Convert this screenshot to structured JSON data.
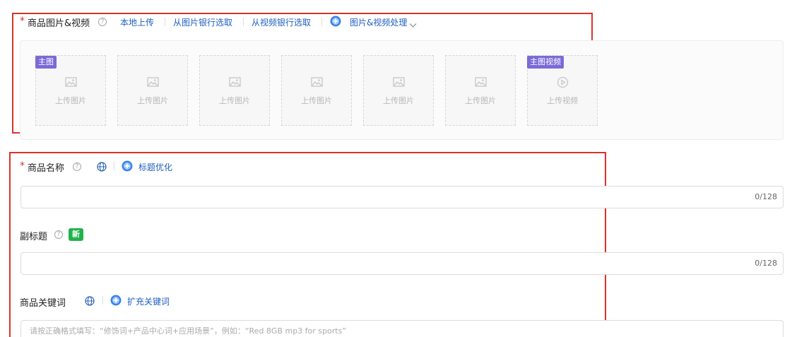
{
  "media_section": {
    "required_mark": "*",
    "label": "商品图片&视频",
    "help_icon": "question-circle-icon",
    "actions": [
      {
        "label": "本地上传"
      },
      {
        "label": "从图片银行选取"
      },
      {
        "label": "从视频银行选取"
      }
    ],
    "ai_action": {
      "icon": "ai-sparkle-icon",
      "label": "图片&视频处理",
      "caret_icon": "chevron-down-icon"
    },
    "main_tag": "主图",
    "video_tag": "主图视频",
    "slots": [
      {
        "text": "上传图片",
        "icon": "image-icon"
      },
      {
        "text": "上传图片",
        "icon": "image-icon"
      },
      {
        "text": "上传图片",
        "icon": "image-icon"
      },
      {
        "text": "上传图片",
        "icon": "image-icon"
      },
      {
        "text": "上传图片",
        "icon": "image-icon"
      },
      {
        "text": "上传图片",
        "icon": "image-icon"
      },
      {
        "text": "上传视频",
        "icon": "play-circle-icon"
      }
    ]
  },
  "title_section": {
    "required_mark": "*",
    "label": "商品名称",
    "help_icon": "question-circle-icon",
    "globe_icon": "globe-icon",
    "ai_action": {
      "icon": "ai-sparkle-icon",
      "label": "标题优化"
    },
    "input_value": "",
    "counter": "0/128"
  },
  "subtitle_section": {
    "label": "副标题",
    "help_icon": "question-circle-icon",
    "badge": "新",
    "input_value": "",
    "counter": "0/128"
  },
  "keyword_section": {
    "label": "商品关键词",
    "globe_icon": "globe-icon",
    "ai_action": {
      "icon": "ai-sparkle-icon",
      "label": "扩充关键词"
    },
    "placeholder": "请按正确格式填写：“修饰词+产品中心词+应用场景”，例如：“Red 8GB mp3 for sports”"
  },
  "colors": {
    "required": "#e02e24",
    "link": "#1f5fbf",
    "tag": "#7a6ad8",
    "badge_new": "#21b24b",
    "highlight_box": "#d9322c"
  }
}
